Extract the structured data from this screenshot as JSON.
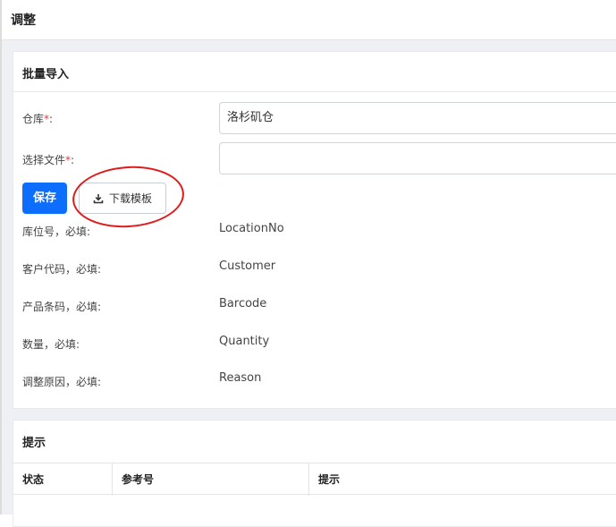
{
  "dialog": {
    "title": "调整"
  },
  "import_card": {
    "title": "批量导入",
    "warehouse": {
      "label": "仓库",
      "required_mark": "*",
      "colon": ":",
      "value": "洛杉矶仓"
    },
    "file": {
      "label": "选择文件",
      "required_mark": "*",
      "colon": ":",
      "value": ""
    },
    "save_label": "保存",
    "download_label": "下载模板",
    "fields": [
      {
        "label": "库位号，必填:",
        "value": "LocationNo"
      },
      {
        "label": "客户代码，必填:",
        "value": "Customer"
      },
      {
        "label": "产品条码，必填:",
        "value": "Barcode"
      },
      {
        "label": "数量，必填:",
        "value": "Quantity"
      },
      {
        "label": "调整原因，必填:",
        "value": "Reason"
      }
    ]
  },
  "tips_card": {
    "title": "提示",
    "columns": [
      "状态",
      "参考号",
      "提示"
    ]
  },
  "colors": {
    "primary": "#0d6efd",
    "required": "#e23b3b",
    "highlight": "#e01b1b"
  },
  "icons": {
    "download": "download-icon"
  }
}
